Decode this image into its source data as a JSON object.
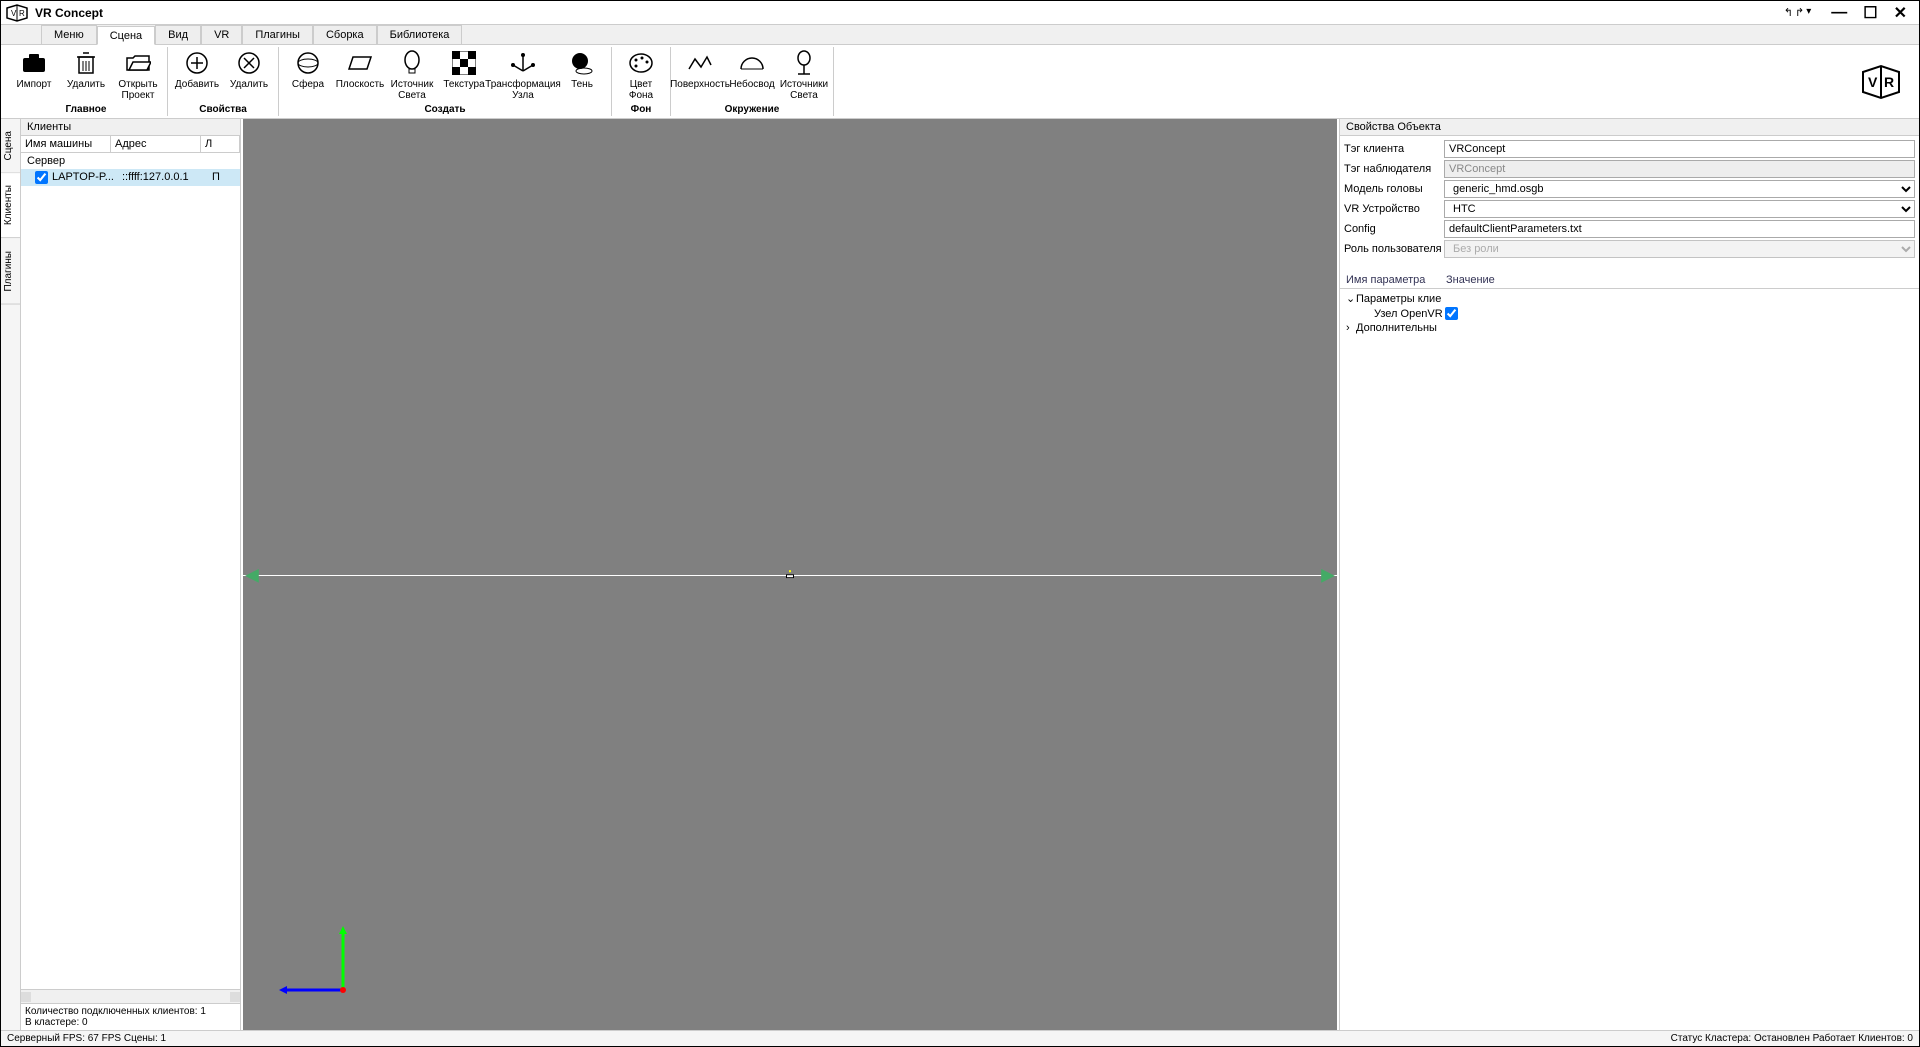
{
  "app": {
    "title": "VR Concept"
  },
  "menus": {
    "items": [
      "Меню",
      "Сцена",
      "Вид",
      "VR",
      "Плагины",
      "Сборка",
      "Библиотека"
    ],
    "activeIndex": 1
  },
  "ribbon": {
    "groups": [
      {
        "label": "Главное",
        "items": [
          {
            "name": "import",
            "label": "Импорт"
          },
          {
            "name": "delete",
            "label": "Удалить"
          },
          {
            "name": "open-project",
            "label": "Открыть\nПроект"
          }
        ]
      },
      {
        "label": "Свойства",
        "items": [
          {
            "name": "add",
            "label": "Добавить"
          },
          {
            "name": "remove",
            "label": "Удалить"
          }
        ]
      },
      {
        "label": "Создать",
        "items": [
          {
            "name": "sphere",
            "label": "Сфера"
          },
          {
            "name": "plane",
            "label": "Плоскость"
          },
          {
            "name": "light-source",
            "label": "Источник\nСвета"
          },
          {
            "name": "texture",
            "label": "Текстура"
          },
          {
            "name": "node-transform",
            "label": "Трансформация\nУзла"
          },
          {
            "name": "shadow",
            "label": "Тень"
          }
        ]
      },
      {
        "label": "Фон",
        "items": [
          {
            "name": "bg-color",
            "label": "Цвет\nФона"
          }
        ]
      },
      {
        "label": "Окружение",
        "items": [
          {
            "name": "surface",
            "label": "Поверхность"
          },
          {
            "name": "sky",
            "label": "Небосвод"
          },
          {
            "name": "light-sources",
            "label": "Источники\nСвета"
          }
        ]
      }
    ]
  },
  "sideTabs": [
    "Сцена",
    "Клиенты",
    "Плагины"
  ],
  "leftPanel": {
    "title": "Клиенты",
    "columns": [
      "Имя машины",
      "Адрес",
      "Л"
    ],
    "serverLabel": "Сервер",
    "row": {
      "name": "LAPTOP-P...",
      "addr": "::ffff:127.0.0.1",
      "flag": "П"
    },
    "footer1": "Количество подключенных клиентов: 1",
    "footer2": "В кластере: 0"
  },
  "rightPanel": {
    "title": "Свойства Объекта",
    "props": {
      "clientTag": {
        "label": "Тэг клиента",
        "value": "VRConcept"
      },
      "observerTag": {
        "label": "Тэг наблюдателя",
        "value": "VRConcept"
      },
      "headModel": {
        "label": "Модель головы",
        "value": "generic_hmd.osgb"
      },
      "vrDevice": {
        "label": "VR Устройство",
        "value": "HTC"
      },
      "config": {
        "label": "Config",
        "value": "defaultClientParameters.txt"
      },
      "userRole": {
        "label": "Роль пользователя",
        "value": "Без роли"
      }
    },
    "paramTable": {
      "col1": "Имя параметра",
      "col2": "Значение",
      "rows": {
        "group1": "Параметры клие",
        "item1": "Узел OpenVR",
        "group2": "Дополнительны"
      }
    }
  },
  "statusbar": {
    "left": "Серверный FPS: 67  FPS Сцены: 1",
    "right": "Статус Кластера: Остановлен  Работает Клиентов: 0"
  }
}
